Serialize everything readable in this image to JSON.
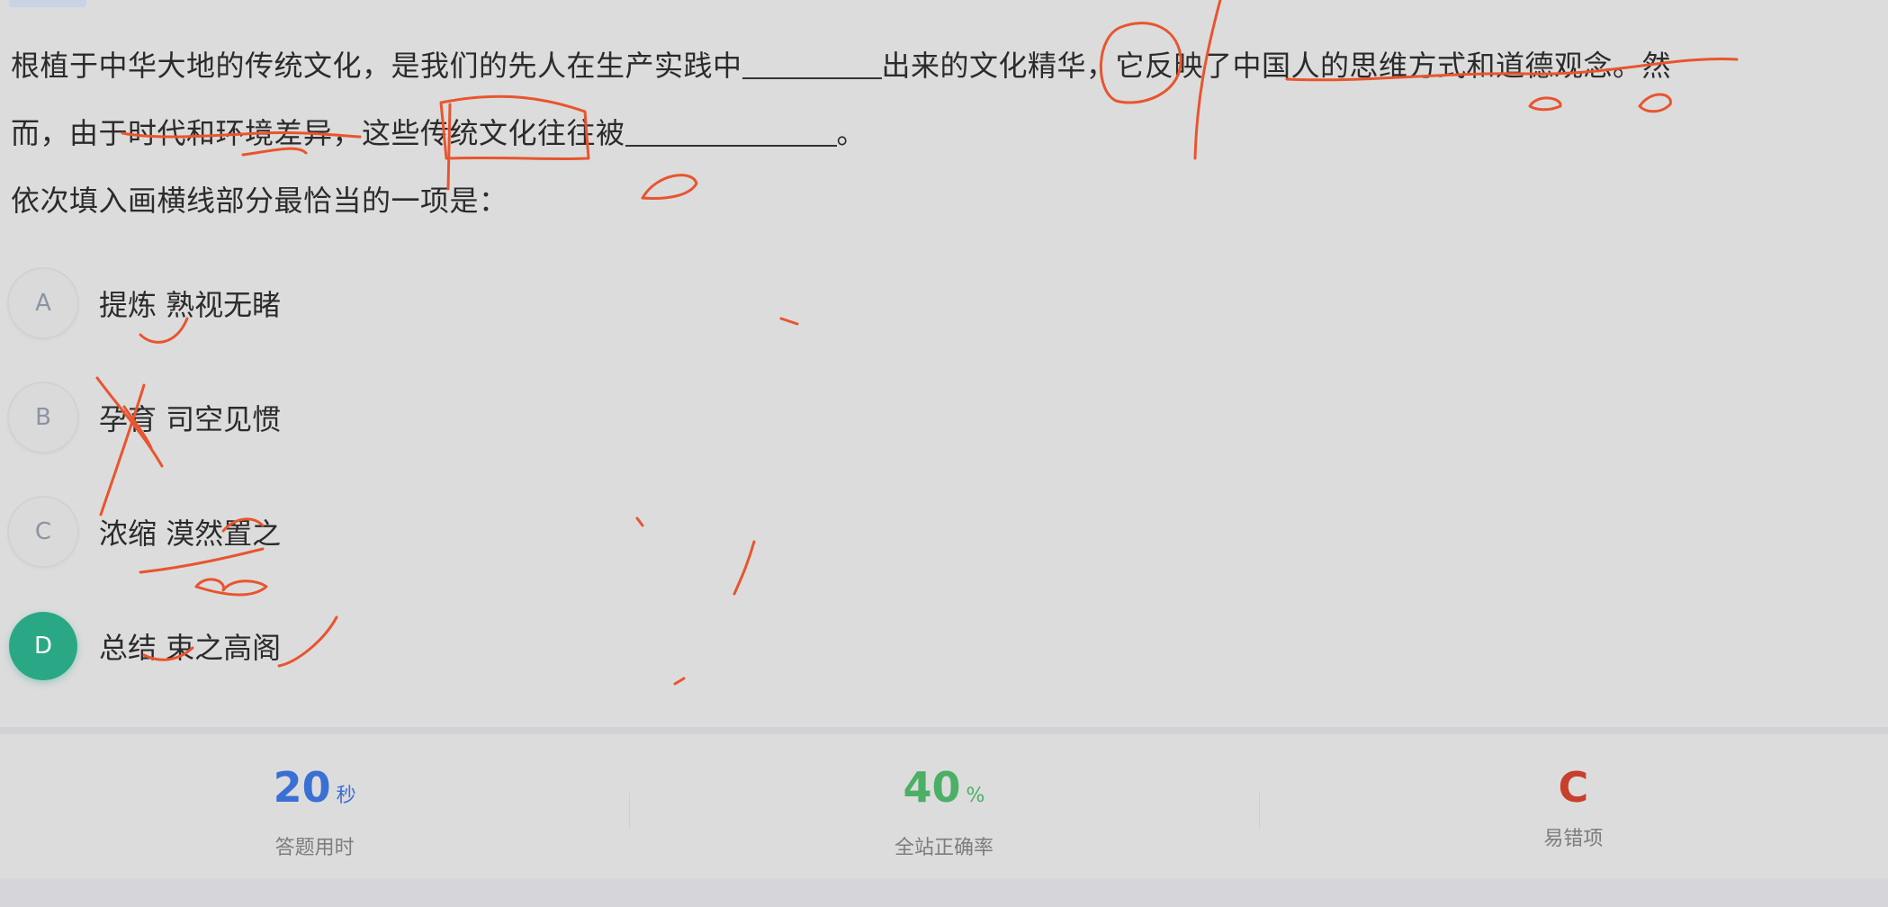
{
  "question": {
    "line1_a": "根植于中华大地的传统文化，是我们的先人在生产实践中",
    "line1_b": "出来的文化精华，它反映了中国人的思维方式和道德观念。然",
    "line2_a": "而，由于时代和环境差异，这些传统文化往往被",
    "line2_b": "。",
    "prompt": "依次填入画横线部分最恰当的一项是："
  },
  "options": [
    {
      "letter": "A",
      "text": "提炼 熟视无睹"
    },
    {
      "letter": "B",
      "text": "孕育 司空见惯"
    },
    {
      "letter": "C",
      "text": "浓缩 漠然置之"
    },
    {
      "letter": "D",
      "text": "总结 束之高阁"
    }
  ],
  "selected_option": "D",
  "stats": {
    "time_value": "20",
    "time_unit": "秒",
    "time_label": "答题用时",
    "accuracy_value": "40",
    "accuracy_unit": "%",
    "accuracy_label": "全站正确率",
    "error_value": "C",
    "error_label": "易错项"
  },
  "colors": {
    "time": "#3a6fd4",
    "accuracy": "#4caf66",
    "error": "#c8402c",
    "selected_badge": "#2aa886",
    "annotation": "#e8552f"
  }
}
